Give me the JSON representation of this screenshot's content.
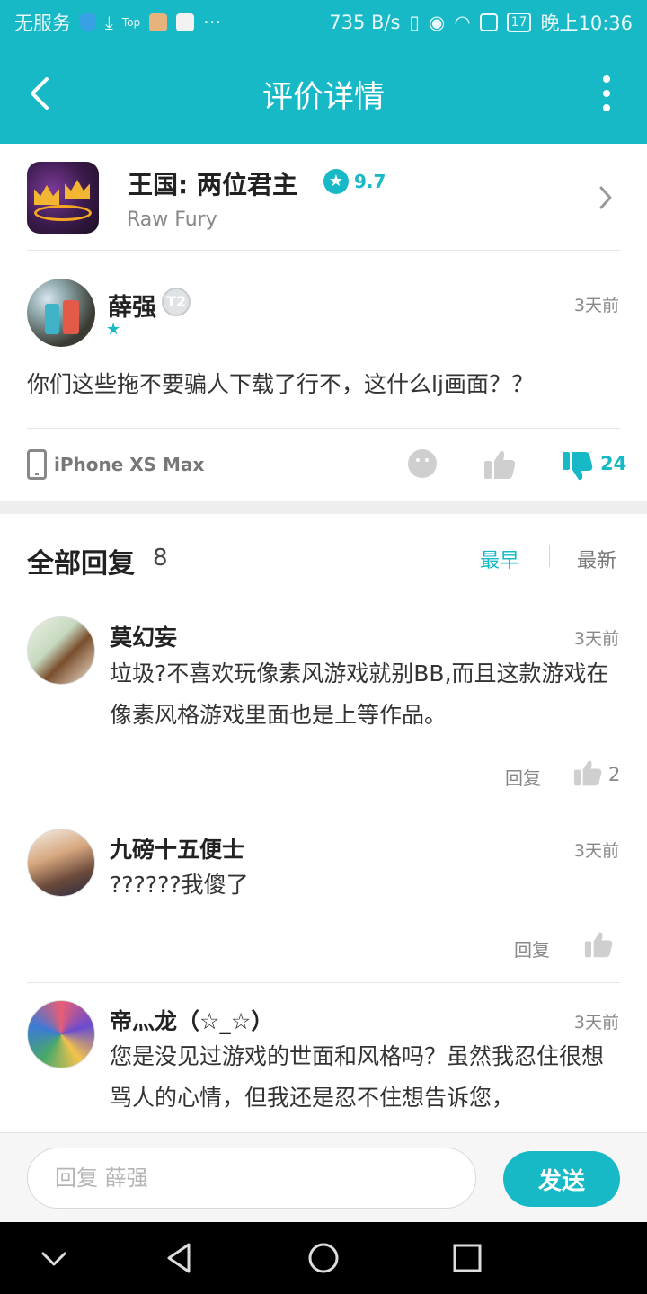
{
  "status_bar": {
    "carrier": "无服务",
    "small_label": "Top",
    "overflow": "···",
    "net_speed": "735 B/s",
    "battery": "17",
    "time": "晚上10:36"
  },
  "header": {
    "title": "评价详情"
  },
  "game": {
    "title": "王国: 两位君主",
    "rating": "9.7",
    "developer": "Raw Fury"
  },
  "review": {
    "user": "薛强",
    "level": "T2",
    "time": "3天前",
    "text": "你们这些拖不要骗人下载了行不，这什么lj画面？？",
    "device": "iPhone XS Max",
    "dislike_count": "24"
  },
  "replies_header": {
    "title": "全部回复",
    "count": "8",
    "sort_earliest": "最早",
    "sort_newest": "最新"
  },
  "replies": [
    {
      "name": "莫幻妄",
      "time": "3天前",
      "text": "垃圾?不喜欢玩像素风游戏就别BB,而且这款游戏在像素风格游戏里面也是上等作品。",
      "reply_label": "回复",
      "likes": "2"
    },
    {
      "name": "九磅十五便士",
      "time": "3天前",
      "text": "??????我傻了",
      "reply_label": "回复",
      "likes": ""
    },
    {
      "name": "帝灬龙（☆_☆）",
      "time": "3天前",
      "text": "您是没见过游戏的世面和风格吗？虽然我忍住很想骂人的心情，但我还是忍不住想告诉您，"
    }
  ],
  "input_bar": {
    "placeholder": "回复 薛强",
    "send_label": "发送"
  },
  "colors": {
    "accent": "#17b9c7",
    "text": "#222222",
    "muted": "#888888"
  },
  "icons": [
    "back-arrow-icon",
    "more-vertical-icon",
    "rating-star-icon",
    "chevron-right-icon",
    "phone-icon",
    "emoji-icon",
    "thumbs-up-icon",
    "thumbs-down-icon",
    "nav-down-icon",
    "nav-back-icon",
    "nav-home-icon",
    "nav-recents-icon"
  ]
}
